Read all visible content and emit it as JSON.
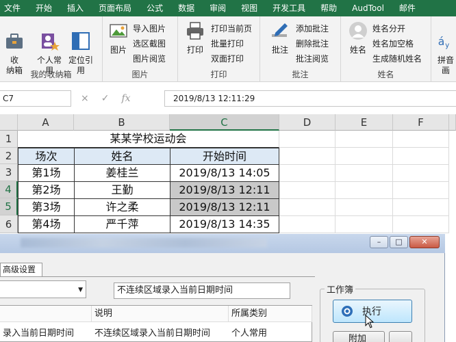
{
  "ribbon_tabs": [
    "文件",
    "开始",
    "插入",
    "页面布局",
    "公式",
    "数据",
    "审阅",
    "视图",
    "开发工具",
    "帮助",
    "AudTool",
    "邮件"
  ],
  "ribbon": {
    "groups": [
      {
        "label": "我的收纳箱"
      },
      {
        "label": "图片"
      },
      {
        "label": "打印"
      },
      {
        "label": "批注"
      },
      {
        "label": "姓名"
      }
    ],
    "buttons": {
      "storage_box": "收\n纳箱",
      "personal_common": "个人常\n用",
      "locate_ref": "定位引\n用",
      "picture": "图片",
      "import_picture": "导入图片",
      "select_screenshot": "选区截图",
      "picture_browse": "图片阅览",
      "print": "打印",
      "print_current_page": "打印当前页",
      "batch_print": "批量打印",
      "duplex_print": "双面打印",
      "comment": "批注",
      "add_comment": "添加批注",
      "delete_comment": "删除批注",
      "comment_browse": "批注阅览",
      "name": "姓名",
      "name_split": "姓名分开",
      "name_add_space": "姓名加空格",
      "random_name": "生成随机姓名",
      "pinyin_label": "拼音\n画"
    }
  },
  "formula_bar": {
    "name_box": "C7",
    "cancel_icon": "×",
    "confirm_icon": "✓",
    "fx_icon": "fx",
    "formula": "2019/8/13  12:11:29"
  },
  "sheet": {
    "columns": [
      "A",
      "B",
      "C",
      "D",
      "E",
      "F"
    ],
    "rows": [
      "1",
      "2",
      "3",
      "4",
      "5",
      "6"
    ],
    "title": "某某学校运动会",
    "headers": [
      "场次",
      "姓名",
      "开始时间"
    ],
    "data": [
      [
        "第1场",
        "姜桂兰",
        "2019/8/13 14:05"
      ],
      [
        "第2场",
        "王勤",
        "2019/8/13 12:11"
      ],
      [
        "第3场",
        "许之柔",
        "2019/8/13 12:11"
      ],
      [
        "第4场",
        "严千萍",
        "2019/8/13 14:35"
      ]
    ]
  },
  "dialog": {
    "window_buttons": [
      "–",
      "□",
      "✕"
    ],
    "tab": "高级设置",
    "description": "不连续区域录入当前日期时间",
    "list_headers": [
      "说明",
      "所属类别"
    ],
    "list_row": [
      "录入当前日期时间",
      "不连续区域录入当前日期时间",
      "个人常用"
    ],
    "group_label": "工作簿",
    "execute_button": "执行",
    "add_button": "附加"
  },
  "colors": {
    "ribbon_green": "#217346",
    "header_fill": "#dde9f5",
    "highlight_fill": "#c9c9c9"
  }
}
